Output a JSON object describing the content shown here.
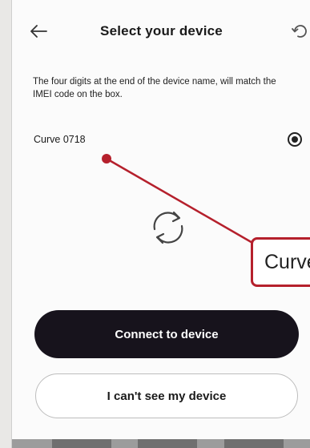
{
  "header": {
    "title": "Select your device",
    "back_icon": "arrow-left-icon",
    "refresh_icon": "refresh-icon"
  },
  "description": "The four digits at the end of the device name, will match the IMEI code on the box.",
  "devices": [
    {
      "name": "Curve 0718",
      "selected": true
    }
  ],
  "callout": {
    "text": "Curve"
  },
  "buttons": {
    "connect_label": "Connect to device",
    "cant_see_label": "I can't see my device"
  },
  "colors": {
    "accent": "#b5202c",
    "primary_button": "#17131c"
  }
}
